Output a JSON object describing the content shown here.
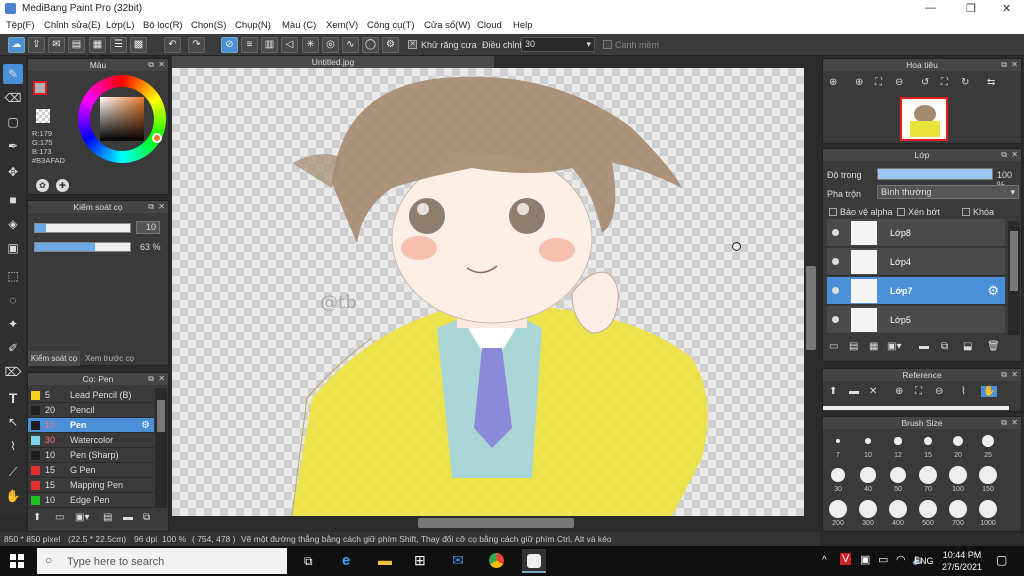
{
  "title": "MediBang Paint Pro (32bit)",
  "window_controls": {
    "minimize": "—",
    "maximize": "❐",
    "close": "✕"
  },
  "menu": [
    "Tệp(F)",
    "Chỉnh sửa(E)",
    "Lớp(L)",
    "Bộ lọc(R)",
    "Chọn(S)",
    "Chụp(N)",
    "Màu (C)",
    "Xem(V)",
    "Công cụ(T)",
    "Cửa sổ(W)",
    "Cloud",
    "Help"
  ],
  "toolbar": {
    "antialias_label": "Khử răng cưa",
    "adjust_label": "Điều chỉnh",
    "adjust_value": "30",
    "edge_label": "Canh mềm"
  },
  "canvas": {
    "tab": "Untitled.jpg",
    "signature": "@tb"
  },
  "color_panel": {
    "title": "Màu",
    "r": "R:179",
    "g": "G:175",
    "b": "B:173",
    "hex": "#B3AFAD",
    "fg_color": "#b3afad"
  },
  "brush_control": {
    "title": "Kiểm soát cọ",
    "size": "10",
    "opacity": "63 %",
    "size_frac": 0.12,
    "opacity_frac": 0.63,
    "tab1": "Kiểm soát cọ",
    "tab2": "Xem trước cọ"
  },
  "brush_panel": {
    "title": "Cọ: Pen",
    "items": [
      {
        "size": "5",
        "name": "Lead Pencil (B)",
        "color": "#f2d21e"
      },
      {
        "size": "20",
        "name": "Pencil",
        "color": "#1e1e1e"
      },
      {
        "size": "10",
        "name": "Pen",
        "color": "#1e1e1e"
      },
      {
        "size": "30",
        "name": "Watercolor",
        "color": "#7ad4f0"
      },
      {
        "size": "10",
        "name": "Pen (Sharp)",
        "color": "#1e1e1e"
      },
      {
        "size": "15",
        "name": "G Pen",
        "color": "#e03030"
      },
      {
        "size": "15",
        "name": "Mapping Pen",
        "color": "#e03030"
      },
      {
        "size": "10",
        "name": "Edge Pen",
        "color": "#20c020"
      }
    ]
  },
  "navigator": {
    "title": "Hoa tiêu"
  },
  "layer_panel": {
    "title": "Lớp",
    "opacity_label": "Độ trong",
    "opacity_value": "100 %",
    "blend_label": "Pha trộn",
    "blend_value": "Bình thường",
    "protect_alpha": "Bảo vệ alpha",
    "clipping": "Xén bớt",
    "lock": "Khóa",
    "layers": [
      {
        "name": "Lớp8"
      },
      {
        "name": "Lớp4"
      },
      {
        "name": "Lớp7"
      },
      {
        "name": "Lớp5"
      }
    ]
  },
  "reference": {
    "title": "Reference"
  },
  "brush_size": {
    "title": "Brush Size",
    "sizes": [
      "7",
      "10",
      "12",
      "15",
      "20",
      "25",
      "30",
      "40",
      "50",
      "70",
      "100",
      "150",
      "200",
      "300",
      "400",
      "500",
      "700",
      "1000"
    ]
  },
  "status": {
    "dims": "850 * 850 pixel",
    "cm": "(22.5 * 22.5cm)",
    "dpi": "96 dpi",
    "zoom": "100 %",
    "pos": "( 754, 478 )",
    "hint": "Vẽ một đường thẳng bằng cách giữ phím Shift, Thay đổi cỡ cọ bằng cách giữ phím Ctrl, Alt và kéo"
  },
  "taskbar": {
    "search": "Type here to search",
    "lang": "ENG",
    "time": "10:44 PM",
    "date": "27/5/2021"
  }
}
